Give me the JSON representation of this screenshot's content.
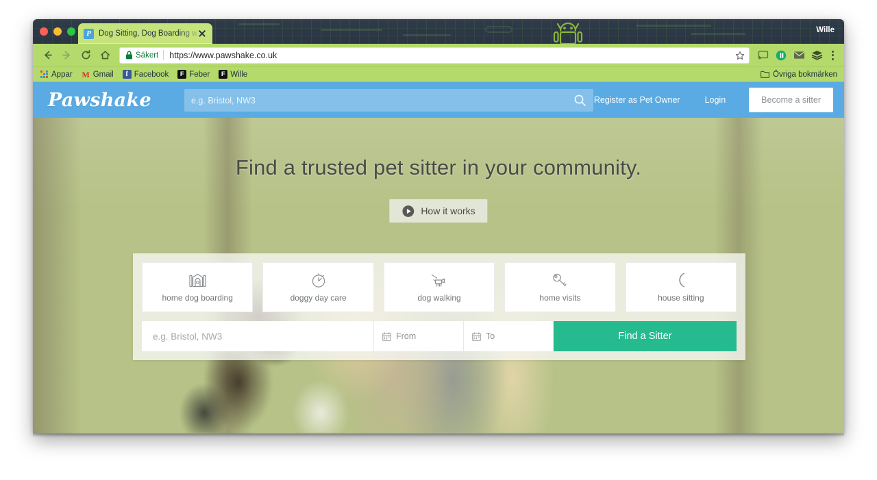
{
  "window": {
    "profile_name": "Wille",
    "traffic_lights": [
      "close",
      "minimize",
      "maximize"
    ],
    "theme_icon": "android-robot-icon"
  },
  "tab": {
    "favicon": "pawshake-favicon",
    "title": "Dog Sitting, Dog Boarding with",
    "close_label": "close-tab"
  },
  "toolbar": {
    "back_icon": "back-arrow-icon",
    "forward_icon": "forward-arrow-icon",
    "reload_icon": "reload-icon",
    "home_icon": "home-icon",
    "security_label": "Säkert",
    "url": "https://www.pawshake.co.uk",
    "bookmark_star_icon": "star-icon",
    "cast_icon": "cast-icon",
    "pocket_icon": "pocket-icon",
    "mail_icon": "mail-icon",
    "layers_icon": "layers-icon",
    "menu_icon": "kebab-menu-icon"
  },
  "bookmarks": {
    "items": [
      {
        "label": "Appar",
        "icon": "apps-grid-icon"
      },
      {
        "label": "Gmail",
        "icon": "gmail-icon"
      },
      {
        "label": "Facebook",
        "icon": "facebook-icon"
      },
      {
        "label": "Feber",
        "icon": "feber-icon"
      },
      {
        "label": "Wille",
        "icon": "feber-icon"
      }
    ],
    "other_label": "Övriga bokmärken",
    "other_icon": "folder-icon"
  },
  "site": {
    "logo": "Pawshake",
    "search": {
      "placeholder": "e.g. Bristol, NW3",
      "icon": "search-icon"
    },
    "nav": [
      {
        "label": "Register as Pet Owner"
      },
      {
        "label": "Login"
      }
    ],
    "cta_button": "Become a sitter"
  },
  "hero": {
    "title": "Find a trusted pet sitter in your community.",
    "how_it_works": {
      "label": "How it works",
      "icon": "play-circle-icon"
    }
  },
  "search_panel": {
    "services": [
      {
        "label": "home dog boarding",
        "icon": "dog-house-icon"
      },
      {
        "label": "doggy day care",
        "icon": "stopwatch-icon"
      },
      {
        "label": "dog walking",
        "icon": "dog-on-leash-icon"
      },
      {
        "label": "home visits",
        "icon": "key-icon"
      },
      {
        "label": "house sitting",
        "icon": "crescent-moon-icon"
      }
    ],
    "location_placeholder": "e.g. Bristol, NW3",
    "date_from_label": "From",
    "date_to_label": "To",
    "date_icon": "calendar-icon",
    "submit_label": "Find a Sitter"
  },
  "colors": {
    "header_blue": "#5aabe3",
    "accent_teal": "#26bb8f",
    "chrome_green": "#b4da6b",
    "tab_green": "#c6e37c",
    "titlebar_dark": "#2f3b4a",
    "secure_green": "#0b7b39"
  }
}
